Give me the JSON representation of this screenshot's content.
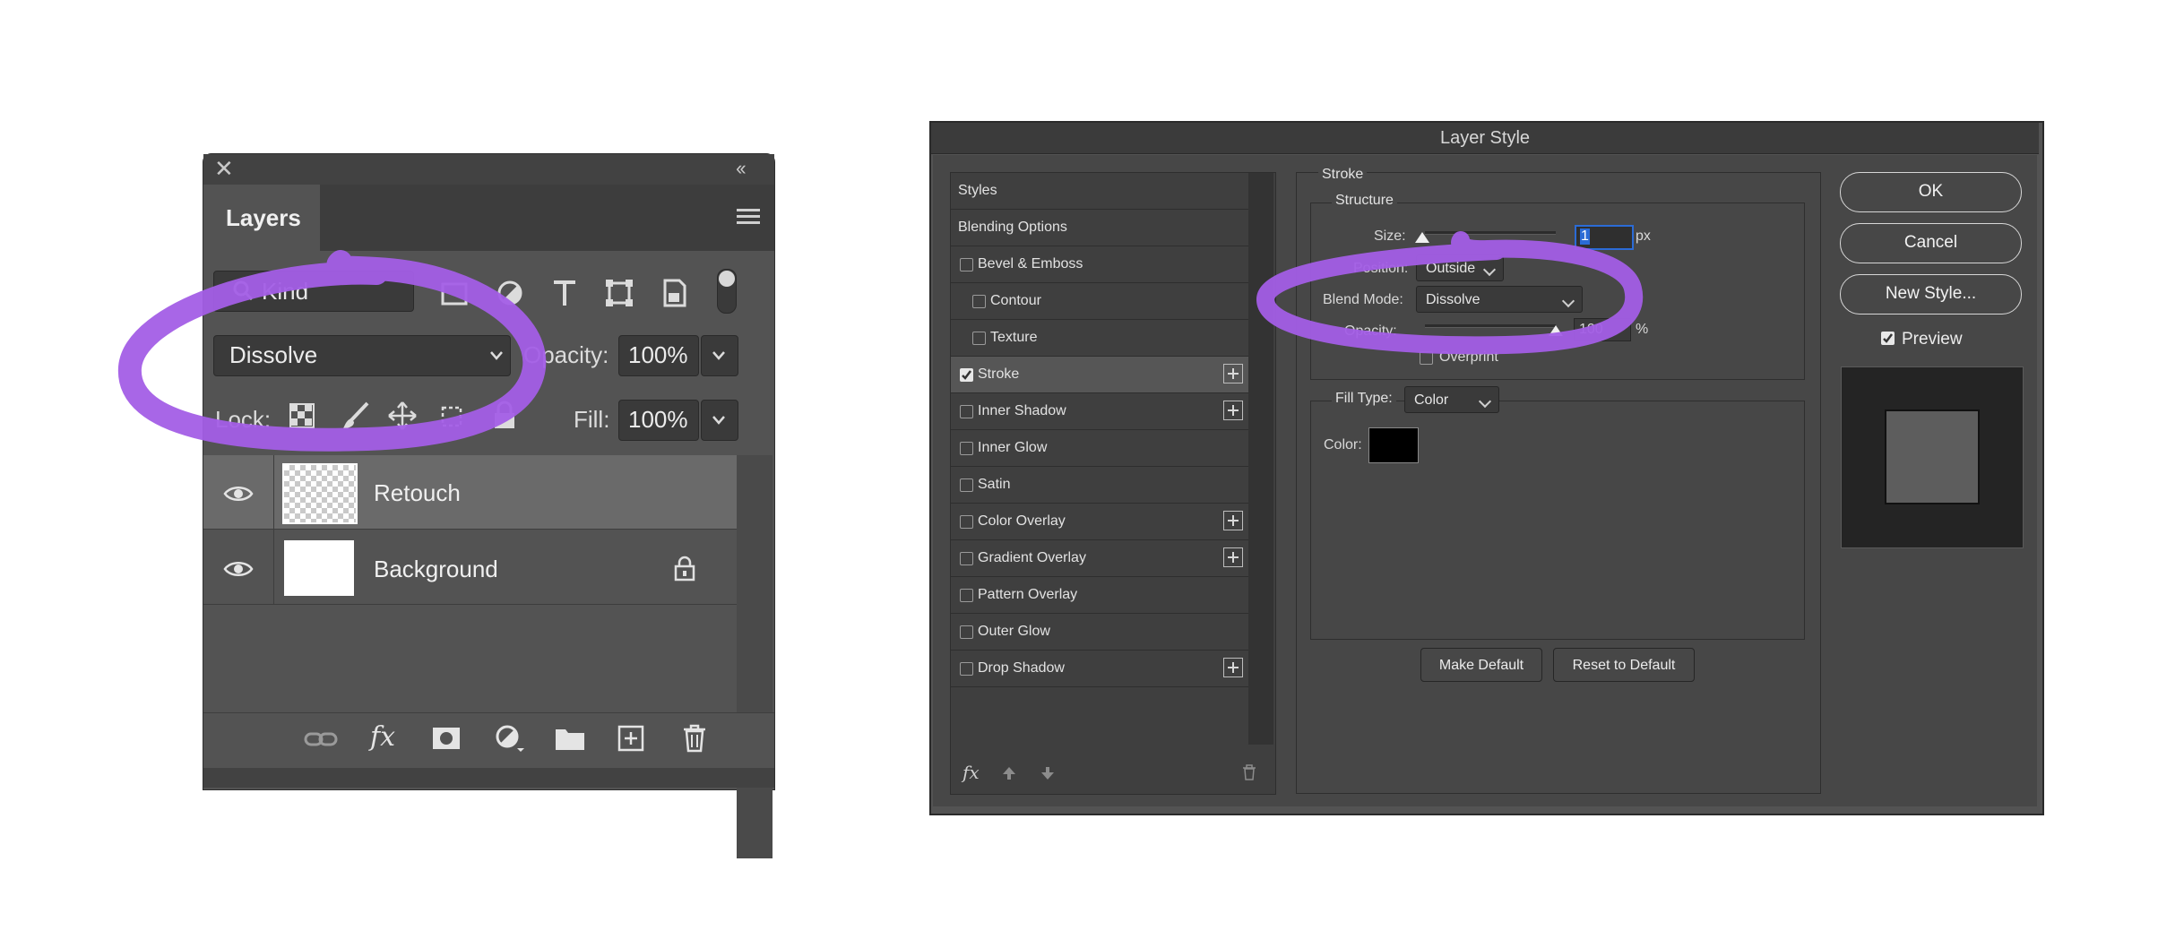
{
  "layers_panel": {
    "tab_label": "Layers",
    "kind_filter": "Kind",
    "blend_mode": "Dissolve",
    "opacity_label": "Opacity:",
    "opacity_value": "100%",
    "lock_label": "Lock:",
    "fill_label": "Fill:",
    "fill_value": "100%",
    "layers": [
      {
        "name": "Retouch",
        "selected": true,
        "visible": true,
        "locked": false
      },
      {
        "name": "Background",
        "selected": false,
        "visible": true,
        "locked": true
      }
    ],
    "bottom_icons": [
      "link-icon",
      "fx-icon",
      "mask-icon",
      "adjustment-icon",
      "folder-icon",
      "new-layer-icon",
      "trash-icon"
    ],
    "fx_label": "fx"
  },
  "layer_style": {
    "title": "Layer Style",
    "styles": [
      {
        "label": "Styles",
        "checkbox": false,
        "plus": false
      },
      {
        "label": "Blending Options",
        "checkbox": false,
        "plus": false
      },
      {
        "label": "Bevel & Emboss",
        "checkbox": true,
        "checked": false,
        "plus": false
      },
      {
        "label": "Contour",
        "checkbox": true,
        "checked": false,
        "plus": false
      },
      {
        "label": "Texture",
        "checkbox": true,
        "checked": false,
        "plus": false
      },
      {
        "label": "Stroke",
        "checkbox": true,
        "checked": true,
        "plus": true
      },
      {
        "label": "Inner Shadow",
        "checkbox": true,
        "checked": false,
        "plus": true
      },
      {
        "label": "Inner Glow",
        "checkbox": true,
        "checked": false,
        "plus": false
      },
      {
        "label": "Satin",
        "checkbox": true,
        "checked": false,
        "plus": false
      },
      {
        "label": "Color Overlay",
        "checkbox": true,
        "checked": false,
        "plus": true
      },
      {
        "label": "Gradient Overlay",
        "checkbox": true,
        "checked": false,
        "plus": true
      },
      {
        "label": "Pattern Overlay",
        "checkbox": true,
        "checked": false,
        "plus": false
      },
      {
        "label": "Outer Glow",
        "checkbox": true,
        "checked": false,
        "plus": false
      },
      {
        "label": "Drop Shadow",
        "checkbox": true,
        "checked": false,
        "plus": true
      }
    ],
    "footer_fx": "fx",
    "stroke": {
      "section_label": "Stroke",
      "structure_label": "Structure",
      "size_label": "Size:",
      "size_value": "1",
      "size_unit": "px",
      "position_label": "Position:",
      "position_value": "Outside",
      "blend_mode_label": "Blend Mode:",
      "blend_mode_value": "Dissolve",
      "opacity_label": "Opacity:",
      "opacity_value": "100",
      "opacity_unit": "%",
      "overprint_label": "Overprint",
      "fill_type_label": "Fill Type:",
      "fill_type_value": "Color",
      "color_label": "Color:",
      "color_value": "#000000"
    },
    "make_default": "Make Default",
    "reset_default": "Reset to Default",
    "ok": "OK",
    "cancel": "Cancel",
    "new_style": "New Style...",
    "preview_label": "Preview",
    "preview_checked": true
  },
  "colors": {
    "annotation": "#a35ee6",
    "panel_bg": "#535353",
    "selected_layer": "#6a6a6a",
    "focus_blue": "#2b6bd6"
  }
}
